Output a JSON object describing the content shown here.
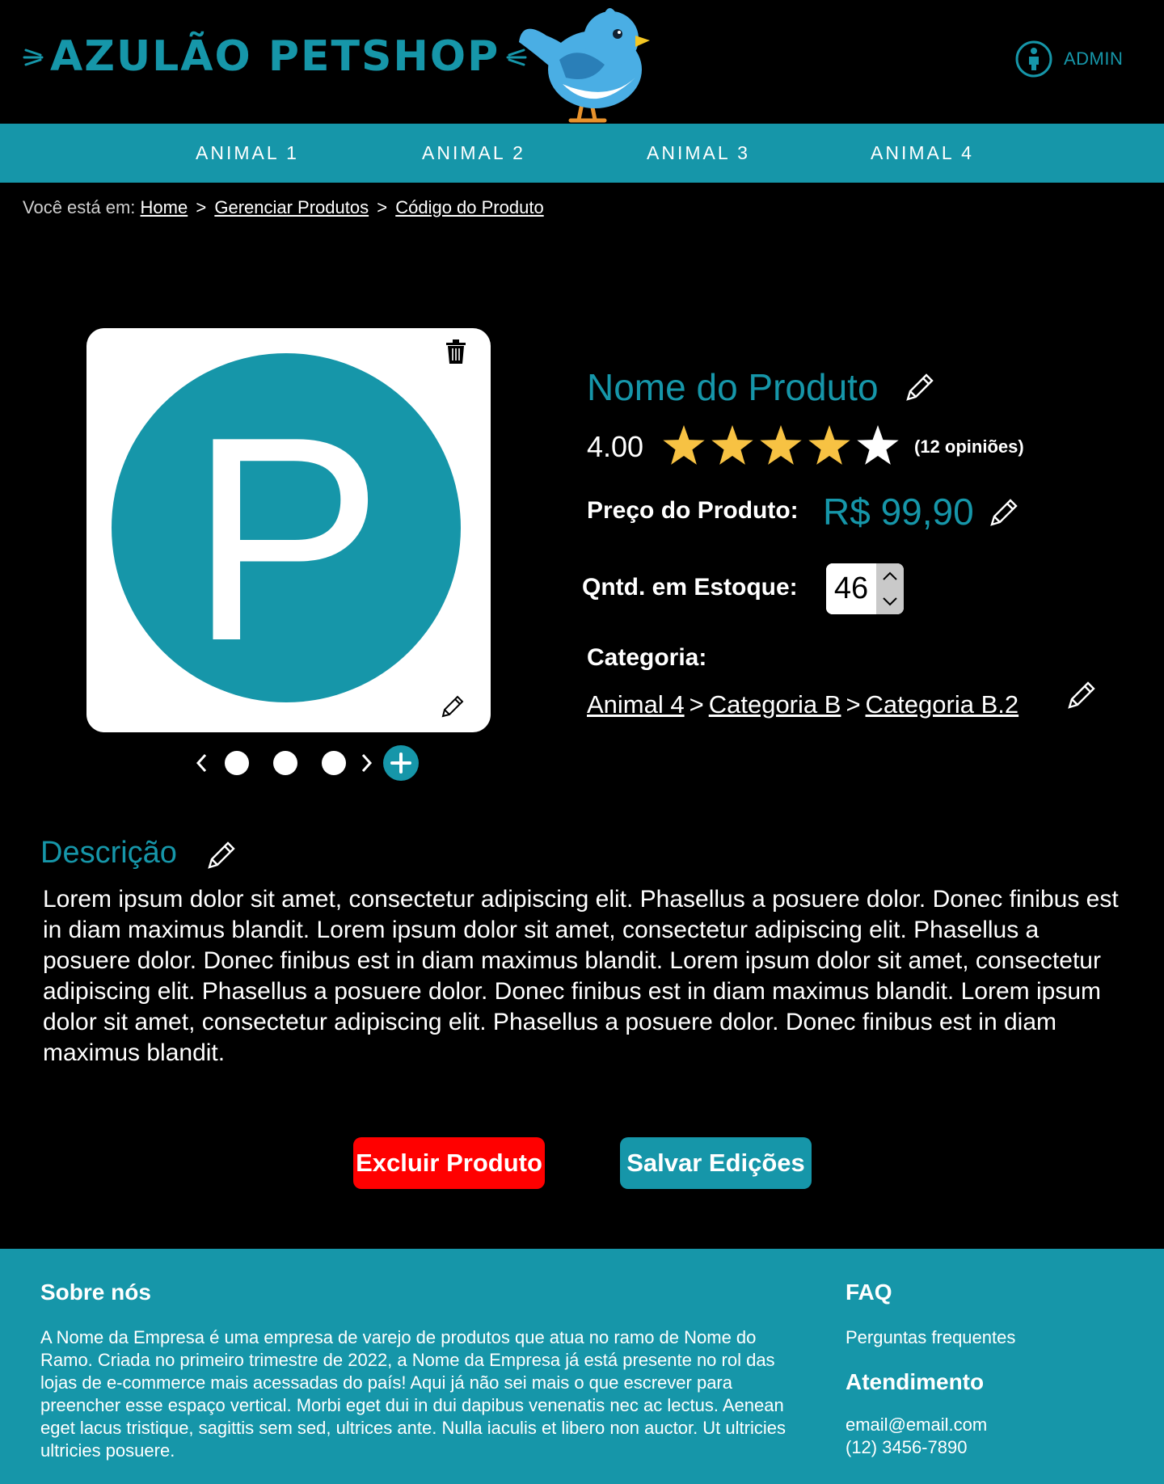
{
  "header": {
    "logo_text": "AZULÃO PETSHOP",
    "admin_label": "ADMIN"
  },
  "nav": {
    "items": [
      "ANIMAL 1",
      "ANIMAL 2",
      "ANIMAL 3",
      "ANIMAL 4"
    ]
  },
  "breadcrumb": {
    "prefix": "Você está em:",
    "items": [
      "Home",
      "Gerenciar Produtos",
      "Código do Produto"
    ],
    "separator": ">"
  },
  "product": {
    "image_letter": "P",
    "name": "Nome do Produto",
    "rating_value": "4.00",
    "rating": 4,
    "rating_max": 5,
    "reviews": "(12 opiniões)",
    "price_label": "Preço do Produto:",
    "price": "R$ 99,90",
    "stock_label": "Qntd. em Estoque:",
    "stock": "46",
    "category_label": "Categoria:",
    "category_path": [
      "Animal 4",
      "Categoria B",
      "Categoria B.2"
    ]
  },
  "carousel": {
    "count": 3
  },
  "description": {
    "title": "Descrição",
    "text": "Lorem ipsum dolor sit amet, consectetur adipiscing elit. Phasellus a posuere dolor. Donec finibus est in diam maximus blandit. Lorem ipsum dolor sit amet, consectetur adipiscing elit. Phasellus a posuere dolor. Donec finibus est in diam maximus blandit. Lorem ipsum dolor sit amet, consectetur adipiscing elit. Phasellus a posuere dolor. Donec finibus est in diam maximus blandit. Lorem ipsum dolor sit amet, consectetur adipiscing elit. Phasellus a posuere dolor. Donec finibus est in diam maximus blandit."
  },
  "actions": {
    "delete_label": "Excluir Produto",
    "save_label": "Salvar Edições"
  },
  "footer": {
    "about_title": "Sobre nós",
    "about_text": "A Nome da Empresa é uma empresa de varejo de produtos que atua no ramo de Nome do Ramo. Criada no primeiro trimestre de 2022, a Nome da Empresa já está presente no rol das  lojas de e-commerce mais acessadas do país! Aqui já não sei mais o que escrever para preencher esse espaço vertical. Morbi eget dui in dui dapibus venenatis nec ac lectus. Aenean eget lacus tristique, sagittis sem sed, ultrices ante. Nulla iaculis et libero non auctor. Ut ultricies ultricies posuere.",
    "faq_title": "FAQ",
    "faq_link": "Perguntas frequentes",
    "support_title": "Atendimento",
    "email": "email@email.com",
    "phone": "(12) 3456-7890"
  },
  "colors": {
    "accent": "#1696a9",
    "danger": "#ff0000",
    "star": "#f7c243",
    "background": "#000000"
  }
}
